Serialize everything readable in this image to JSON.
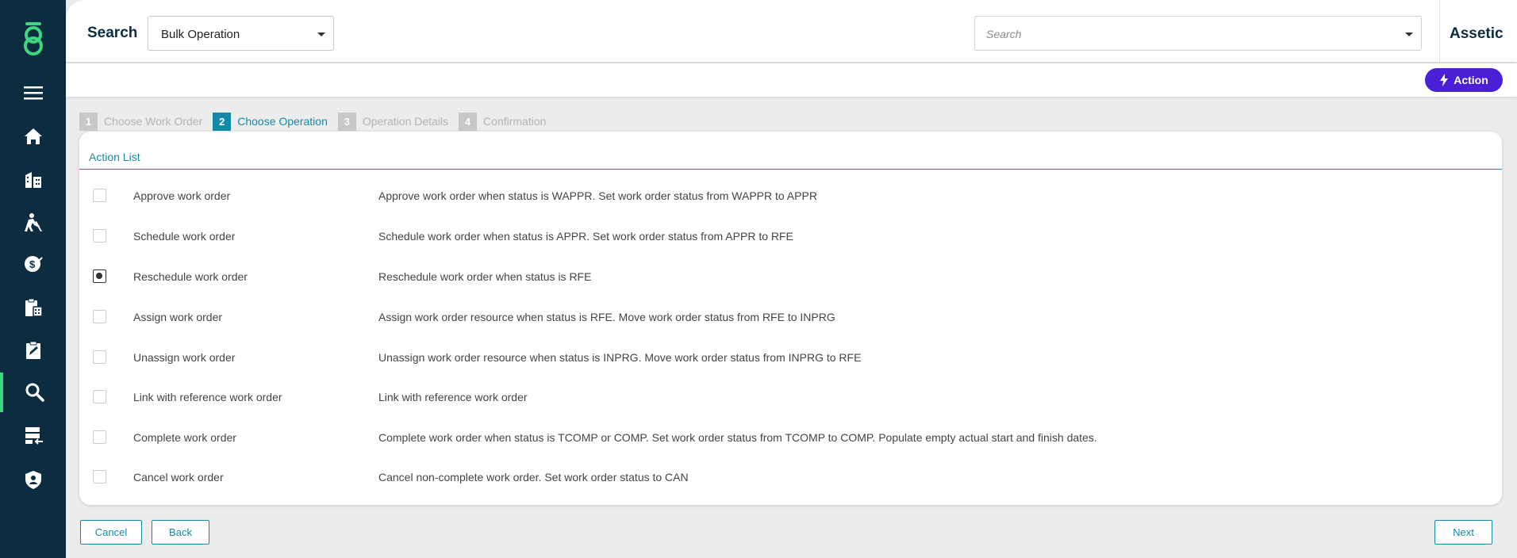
{
  "header": {
    "search_label": "Search",
    "operation_select": {
      "selected": "Bulk Operation"
    },
    "search_input": {
      "value": "",
      "placeholder": "Search"
    },
    "brand": "Assetic"
  },
  "action_bar": {
    "action_label": "Action"
  },
  "sidebar": {
    "icons": [
      "menu-icon",
      "home-icon",
      "buildings-icon",
      "worker-icon",
      "finance-icon",
      "clipboard-calculator-icon",
      "clipboard-edit-icon",
      "search-icon",
      "data-import-icon",
      "shield-user-icon"
    ],
    "active": "search-icon"
  },
  "steps": [
    {
      "num": "1",
      "label": "Choose Work Order",
      "active": false
    },
    {
      "num": "2",
      "label": "Choose Operation",
      "active": true
    },
    {
      "num": "3",
      "label": "Operation Details",
      "active": false
    },
    {
      "num": "4",
      "label": "Confirmation",
      "active": false
    }
  ],
  "action_list": {
    "title": "Action List",
    "rows": [
      {
        "name": "Approve work order",
        "description": "Approve work order when status is WAPPR. Set work order status from WAPPR to APPR",
        "checked": false
      },
      {
        "name": "Schedule work order",
        "description": "Schedule work order when status is APPR. Set work order status from APPR to RFE",
        "checked": false
      },
      {
        "name": "Reschedule work order",
        "description": "Reschedule work order when status is RFE",
        "checked": true
      },
      {
        "name": "Assign work order",
        "description": "Assign work order resource when status is RFE. Move work order status from RFE to INPRG",
        "checked": false
      },
      {
        "name": "Unassign work order",
        "description": "Unassign work order resource when status is INPRG. Move work order status from INPRG to RFE",
        "checked": false
      },
      {
        "name": "Link with reference work order",
        "description": "Link with reference work order",
        "checked": false
      },
      {
        "name": "Complete work order",
        "description": "Complete work order when status is TCOMP or COMP. Set work order status from TCOMP to COMP. Populate empty actual start and finish dates.",
        "checked": false
      },
      {
        "name": "Cancel work order",
        "description": "Cancel non-complete work order. Set work order status to CAN",
        "checked": false
      }
    ]
  },
  "footer": {
    "cancel_label": "Cancel",
    "back_label": "Back",
    "next_label": "Next"
  },
  "colors": {
    "sidebar": "#0c2c3f",
    "accent": "#1689a6",
    "action": "#4a1fd6",
    "logo": "#3fd67f"
  }
}
